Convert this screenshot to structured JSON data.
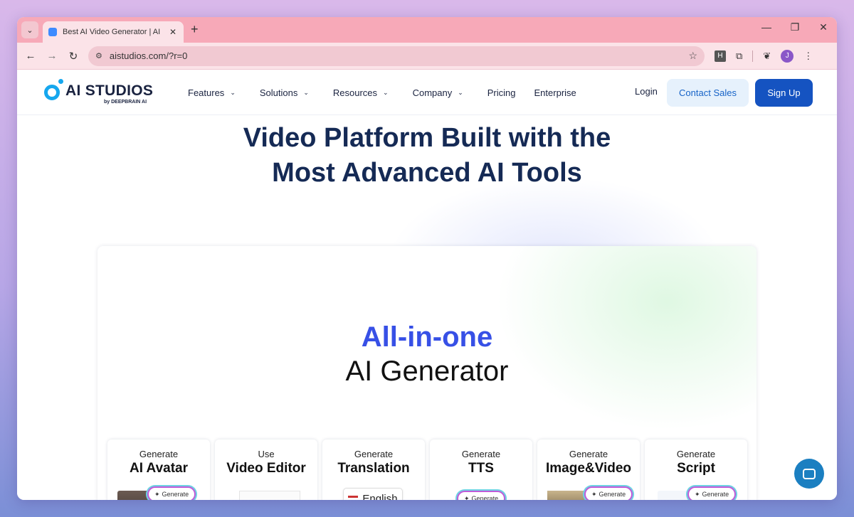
{
  "browser": {
    "tab_title": "Best AI Video Generator | AI STU",
    "url": "aistudios.com/?r=0",
    "profile_initial": "J",
    "ext_h_label": "H"
  },
  "header": {
    "logo_text": "AI STUDIOS",
    "logo_sub": "by DEEPBRAIN AI",
    "nav": [
      "Features",
      "Solutions",
      "Resources",
      "Company",
      "Pricing",
      "Enterprise"
    ],
    "login": "Login",
    "contact_sales": "Contact Sales",
    "sign_up": "Sign Up"
  },
  "hero": {
    "title_line1": "Video Platform Built with the",
    "title_line2": "Most Advanced AI Tools"
  },
  "card": {
    "title_accent": "All-in-one",
    "title_main": "AI Generator",
    "features": [
      {
        "verb": "Generate",
        "noun": "AI Avatar"
      },
      {
        "verb": "Use",
        "noun": "Video Editor"
      },
      {
        "verb": "Generate",
        "noun": "Translation"
      },
      {
        "verb": "Generate",
        "noun": "TTS"
      },
      {
        "verb": "Generate",
        "noun": "Image&Video"
      },
      {
        "verb": "Generate",
        "noun": "Script"
      }
    ],
    "generate_label": "Generate",
    "language_label": "English"
  },
  "colors": {
    "accent": "#3750e6",
    "primary_button": "#1553c1",
    "heading": "#152a55"
  }
}
